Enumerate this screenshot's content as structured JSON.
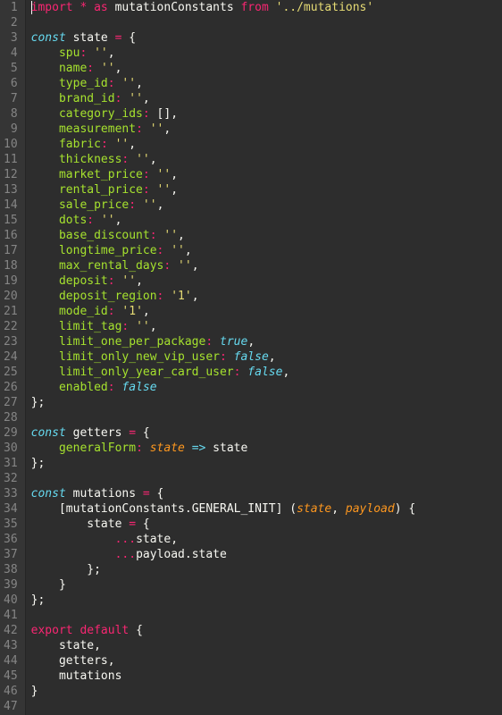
{
  "editor": {
    "language": "javascript",
    "line_count": 47
  },
  "lines": {
    "1": {
      "n": "1",
      "tokens": [
        [
          "kw",
          "import"
        ],
        [
          "id",
          " "
        ],
        [
          "op",
          "*"
        ],
        [
          "id",
          " "
        ],
        [
          "kw",
          "as"
        ],
        [
          "id",
          " mutationConstants "
        ],
        [
          "kw",
          "from"
        ],
        [
          "id",
          " "
        ],
        [
          "str",
          "'../mutations'"
        ]
      ]
    },
    "2": {
      "n": "2",
      "tokens": []
    },
    "3": {
      "n": "3",
      "tokens": [
        [
          "kw2",
          "const"
        ],
        [
          "id",
          " state "
        ],
        [
          "op",
          "="
        ],
        [
          "id",
          " "
        ],
        [
          "punc",
          "{"
        ]
      ]
    },
    "4": {
      "n": "4",
      "tokens": [
        [
          "id",
          "    "
        ],
        [
          "fn",
          "spu"
        ],
        [
          "op",
          ":"
        ],
        [
          "id",
          " "
        ],
        [
          "str",
          "''"
        ],
        [
          "punc",
          ","
        ]
      ]
    },
    "5": {
      "n": "5",
      "tokens": [
        [
          "id",
          "    "
        ],
        [
          "fn",
          "name"
        ],
        [
          "op",
          ":"
        ],
        [
          "id",
          " "
        ],
        [
          "str",
          "''"
        ],
        [
          "punc",
          ","
        ]
      ]
    },
    "6": {
      "n": "6",
      "tokens": [
        [
          "id",
          "    "
        ],
        [
          "fn",
          "type_id"
        ],
        [
          "op",
          ":"
        ],
        [
          "id",
          " "
        ],
        [
          "str",
          "''"
        ],
        [
          "punc",
          ","
        ]
      ]
    },
    "7": {
      "n": "7",
      "tokens": [
        [
          "id",
          "    "
        ],
        [
          "fn",
          "brand_id"
        ],
        [
          "op",
          ":"
        ],
        [
          "id",
          " "
        ],
        [
          "str",
          "''"
        ],
        [
          "punc",
          ","
        ]
      ]
    },
    "8": {
      "n": "8",
      "tokens": [
        [
          "id",
          "    "
        ],
        [
          "fn",
          "category_ids"
        ],
        [
          "op",
          ":"
        ],
        [
          "id",
          " "
        ],
        [
          "punc",
          "[]"
        ],
        [
          "punc",
          ","
        ]
      ]
    },
    "9": {
      "n": "9",
      "tokens": [
        [
          "id",
          "    "
        ],
        [
          "fn",
          "measurement"
        ],
        [
          "op",
          ":"
        ],
        [
          "id",
          " "
        ],
        [
          "str",
          "''"
        ],
        [
          "punc",
          ","
        ]
      ]
    },
    "10": {
      "n": "10",
      "tokens": [
        [
          "id",
          "    "
        ],
        [
          "fn",
          "fabric"
        ],
        [
          "op",
          ":"
        ],
        [
          "id",
          " "
        ],
        [
          "str",
          "''"
        ],
        [
          "punc",
          ","
        ]
      ]
    },
    "11": {
      "n": "11",
      "tokens": [
        [
          "id",
          "    "
        ],
        [
          "fn",
          "thickness"
        ],
        [
          "op",
          ":"
        ],
        [
          "id",
          " "
        ],
        [
          "str",
          "''"
        ],
        [
          "punc",
          ","
        ]
      ]
    },
    "12": {
      "n": "12",
      "tokens": [
        [
          "id",
          "    "
        ],
        [
          "fn",
          "market_price"
        ],
        [
          "op",
          ":"
        ],
        [
          "id",
          " "
        ],
        [
          "str",
          "''"
        ],
        [
          "punc",
          ","
        ]
      ]
    },
    "13": {
      "n": "13",
      "tokens": [
        [
          "id",
          "    "
        ],
        [
          "fn",
          "rental_price"
        ],
        [
          "op",
          ":"
        ],
        [
          "id",
          " "
        ],
        [
          "str",
          "''"
        ],
        [
          "punc",
          ","
        ]
      ]
    },
    "14": {
      "n": "14",
      "tokens": [
        [
          "id",
          "    "
        ],
        [
          "fn",
          "sale_price"
        ],
        [
          "op",
          ":"
        ],
        [
          "id",
          " "
        ],
        [
          "str",
          "''"
        ],
        [
          "punc",
          ","
        ]
      ]
    },
    "15": {
      "n": "15",
      "tokens": [
        [
          "id",
          "    "
        ],
        [
          "fn",
          "dots"
        ],
        [
          "op",
          ":"
        ],
        [
          "id",
          " "
        ],
        [
          "str",
          "''"
        ],
        [
          "punc",
          ","
        ]
      ]
    },
    "16": {
      "n": "16",
      "tokens": [
        [
          "id",
          "    "
        ],
        [
          "fn",
          "base_discount"
        ],
        [
          "op",
          ":"
        ],
        [
          "id",
          " "
        ],
        [
          "str",
          "''"
        ],
        [
          "punc",
          ","
        ]
      ]
    },
    "17": {
      "n": "17",
      "tokens": [
        [
          "id",
          "    "
        ],
        [
          "fn",
          "longtime_price"
        ],
        [
          "op",
          ":"
        ],
        [
          "id",
          " "
        ],
        [
          "str",
          "''"
        ],
        [
          "punc",
          ","
        ]
      ]
    },
    "18": {
      "n": "18",
      "tokens": [
        [
          "id",
          "    "
        ],
        [
          "fn",
          "max_rental_days"
        ],
        [
          "op",
          ":"
        ],
        [
          "id",
          " "
        ],
        [
          "str",
          "''"
        ],
        [
          "punc",
          ","
        ]
      ]
    },
    "19": {
      "n": "19",
      "tokens": [
        [
          "id",
          "    "
        ],
        [
          "fn",
          "deposit"
        ],
        [
          "op",
          ":"
        ],
        [
          "id",
          " "
        ],
        [
          "str",
          "''"
        ],
        [
          "punc",
          ","
        ]
      ]
    },
    "20": {
      "n": "20",
      "tokens": [
        [
          "id",
          "    "
        ],
        [
          "fn",
          "deposit_region"
        ],
        [
          "op",
          ":"
        ],
        [
          "id",
          " "
        ],
        [
          "str",
          "'1'"
        ],
        [
          "punc",
          ","
        ]
      ]
    },
    "21": {
      "n": "21",
      "tokens": [
        [
          "id",
          "    "
        ],
        [
          "fn",
          "mode_id"
        ],
        [
          "op",
          ":"
        ],
        [
          "id",
          " "
        ],
        [
          "str",
          "'1'"
        ],
        [
          "punc",
          ","
        ]
      ]
    },
    "22": {
      "n": "22",
      "tokens": [
        [
          "id",
          "    "
        ],
        [
          "fn",
          "limit_tag"
        ],
        [
          "op",
          ":"
        ],
        [
          "id",
          " "
        ],
        [
          "str",
          "''"
        ],
        [
          "punc",
          ","
        ]
      ]
    },
    "23": {
      "n": "23",
      "tokens": [
        [
          "id",
          "    "
        ],
        [
          "fn",
          "limit_one_per_package"
        ],
        [
          "op",
          ":"
        ],
        [
          "id",
          " "
        ],
        [
          "kw2",
          "true"
        ],
        [
          "punc",
          ","
        ]
      ]
    },
    "24": {
      "n": "24",
      "tokens": [
        [
          "id",
          "    "
        ],
        [
          "fn",
          "limit_only_new_vip_user"
        ],
        [
          "op",
          ":"
        ],
        [
          "id",
          " "
        ],
        [
          "kw2",
          "false"
        ],
        [
          "punc",
          ","
        ]
      ]
    },
    "25": {
      "n": "25",
      "tokens": [
        [
          "id",
          "    "
        ],
        [
          "fn",
          "limit_only_year_card_user"
        ],
        [
          "op",
          ":"
        ],
        [
          "id",
          " "
        ],
        [
          "kw2",
          "false"
        ],
        [
          "punc",
          ","
        ]
      ]
    },
    "26": {
      "n": "26",
      "tokens": [
        [
          "id",
          "    "
        ],
        [
          "fn",
          "enabled"
        ],
        [
          "op",
          ":"
        ],
        [
          "id",
          " "
        ],
        [
          "kw2",
          "false"
        ]
      ]
    },
    "27": {
      "n": "27",
      "tokens": [
        [
          "punc",
          "};"
        ]
      ]
    },
    "28": {
      "n": "28",
      "tokens": []
    },
    "29": {
      "n": "29",
      "tokens": [
        [
          "kw2",
          "const"
        ],
        [
          "id",
          " getters "
        ],
        [
          "op",
          "="
        ],
        [
          "id",
          " "
        ],
        [
          "punc",
          "{"
        ]
      ]
    },
    "30": {
      "n": "30",
      "tokens": [
        [
          "id",
          "    "
        ],
        [
          "fn",
          "generalForm"
        ],
        [
          "op",
          ":"
        ],
        [
          "id",
          " "
        ],
        [
          "param",
          "state"
        ],
        [
          "id",
          " "
        ],
        [
          "kw2",
          "=>"
        ],
        [
          "id",
          " state"
        ]
      ]
    },
    "31": {
      "n": "31",
      "tokens": [
        [
          "punc",
          "};"
        ]
      ]
    },
    "32": {
      "n": "32",
      "tokens": []
    },
    "33": {
      "n": "33",
      "tokens": [
        [
          "kw2",
          "const"
        ],
        [
          "id",
          " mutations "
        ],
        [
          "op",
          "="
        ],
        [
          "id",
          " "
        ],
        [
          "punc",
          "{"
        ]
      ]
    },
    "34": {
      "n": "34",
      "tokens": [
        [
          "id",
          "    "
        ],
        [
          "punc",
          "["
        ],
        [
          "id",
          "mutationConstants"
        ],
        [
          "punc",
          "."
        ],
        [
          "id",
          "GENERAL_INIT"
        ],
        [
          "punc",
          "]"
        ],
        [
          "id",
          " "
        ],
        [
          "punc",
          "("
        ],
        [
          "param",
          "state"
        ],
        [
          "punc",
          ", "
        ],
        [
          "param",
          "payload"
        ],
        [
          "punc",
          ")"
        ],
        [
          "id",
          " "
        ],
        [
          "punc",
          "{"
        ]
      ]
    },
    "35": {
      "n": "35",
      "tokens": [
        [
          "id",
          "        state "
        ],
        [
          "op",
          "="
        ],
        [
          "id",
          " "
        ],
        [
          "punc",
          "{"
        ]
      ]
    },
    "36": {
      "n": "36",
      "tokens": [
        [
          "id",
          "            "
        ],
        [
          "op",
          "..."
        ],
        [
          "id",
          "state"
        ],
        [
          "punc",
          ","
        ]
      ]
    },
    "37": {
      "n": "37",
      "tokens": [
        [
          "id",
          "            "
        ],
        [
          "op",
          "..."
        ],
        [
          "id",
          "payload"
        ],
        [
          "punc",
          "."
        ],
        [
          "id",
          "state"
        ]
      ]
    },
    "38": {
      "n": "38",
      "tokens": [
        [
          "id",
          "        "
        ],
        [
          "punc",
          "};"
        ]
      ]
    },
    "39": {
      "n": "39",
      "tokens": [
        [
          "id",
          "    "
        ],
        [
          "punc",
          "}"
        ]
      ]
    },
    "40": {
      "n": "40",
      "tokens": [
        [
          "punc",
          "};"
        ]
      ]
    },
    "41": {
      "n": "41",
      "tokens": []
    },
    "42": {
      "n": "42",
      "tokens": [
        [
          "kw",
          "export"
        ],
        [
          "id",
          " "
        ],
        [
          "kw",
          "default"
        ],
        [
          "id",
          " "
        ],
        [
          "punc",
          "{"
        ]
      ]
    },
    "43": {
      "n": "43",
      "tokens": [
        [
          "id",
          "    state"
        ],
        [
          "punc",
          ","
        ]
      ]
    },
    "44": {
      "n": "44",
      "tokens": [
        [
          "id",
          "    getters"
        ],
        [
          "punc",
          ","
        ]
      ]
    },
    "45": {
      "n": "45",
      "tokens": [
        [
          "id",
          "    mutations"
        ]
      ]
    },
    "46": {
      "n": "46",
      "tokens": [
        [
          "punc",
          "}"
        ]
      ]
    },
    "47": {
      "n": "47",
      "tokens": []
    }
  }
}
